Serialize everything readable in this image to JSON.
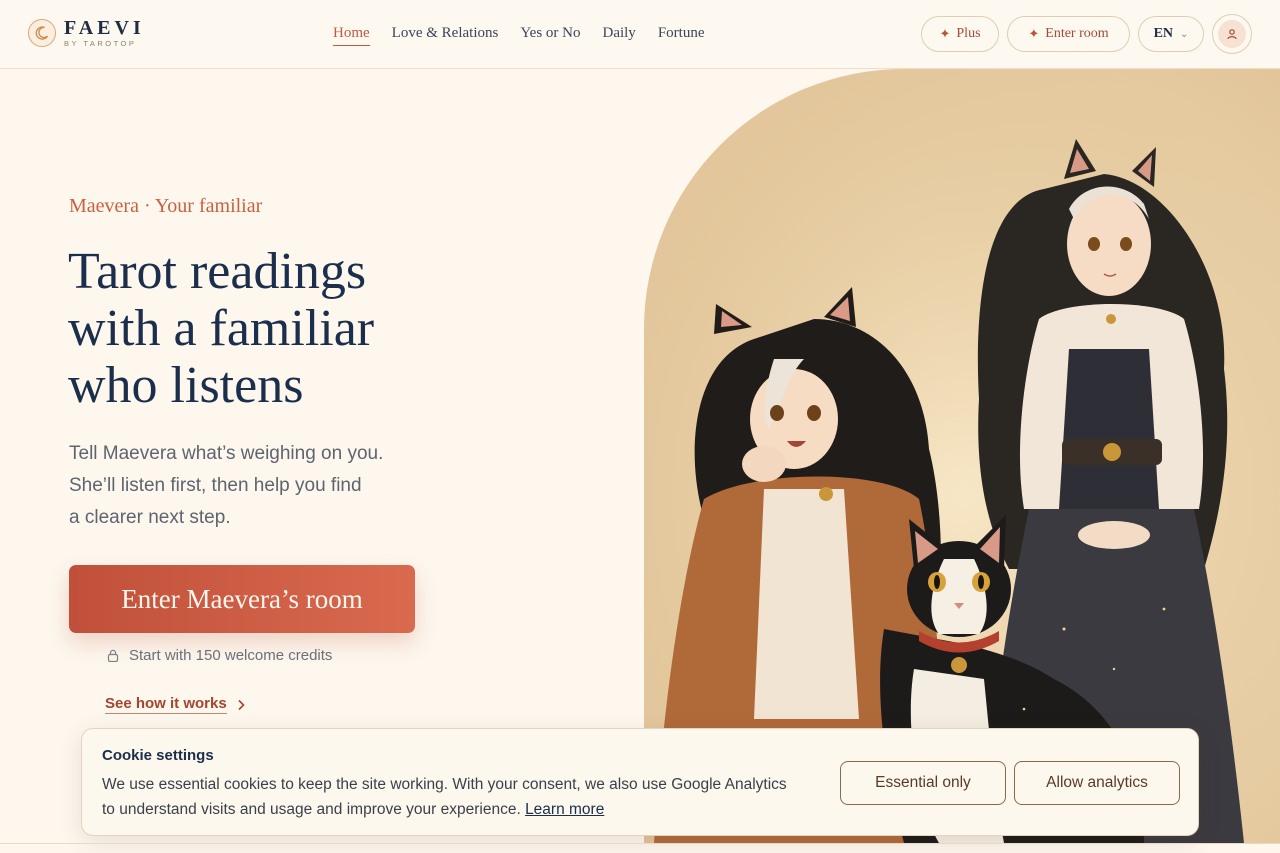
{
  "brand": {
    "name": "FAEVI",
    "tagline": "BY TAROTOP",
    "icon": "crescent-moon-icon"
  },
  "nav": {
    "items": [
      {
        "label": "Home",
        "active": true
      },
      {
        "label": "Love & Relations",
        "active": false
      },
      {
        "label": "Yes or No",
        "active": false
      },
      {
        "label": "Daily",
        "active": false
      },
      {
        "label": "Fortune",
        "active": false
      }
    ]
  },
  "header_actions": {
    "plus_label": "Plus",
    "enter_room_label": "Enter room",
    "language": "EN",
    "account_icon": "user-icon"
  },
  "hero": {
    "eyebrow": "Maevera · Your familiar",
    "headline_lines": [
      "Tarot readings",
      "with a familiar",
      "who listens"
    ],
    "subtext_lines": [
      "Tell Maevera what’s weighing on you.",
      "She’ll listen first, then help you find",
      "a clearer next step."
    ],
    "cta_label": "Enter Maevera’s room",
    "credits_note": "Start with 150 welcome credits",
    "how_link": "See how it works"
  },
  "artwork": {
    "description_icon": "illustration-two-cat-eared-girls-and-black-white-cat"
  },
  "cookie": {
    "title": "Cookie settings",
    "body": "We use essential cookies to keep the site working. With your consent, we also use Google Analytics to understand visits and usage and improve your experience.",
    "learn_more": "Learn more",
    "essential_label": "Essential only",
    "allow_label": "Allow analytics"
  },
  "colors": {
    "accent": "#c25a40",
    "navy": "#1b2e4b",
    "background": "#fdf7ee"
  }
}
